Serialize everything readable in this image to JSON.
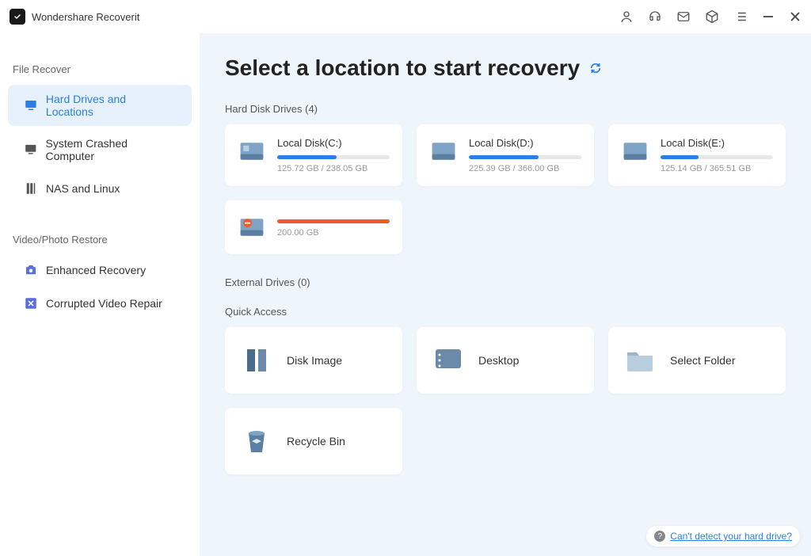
{
  "app": {
    "title": "Wondershare Recoverit"
  },
  "sidebar": {
    "section1": "File Recover",
    "section2": "Video/Photo Restore",
    "items1": [
      {
        "label": "Hard Drives and Locations"
      },
      {
        "label": "System Crashed Computer"
      },
      {
        "label": "NAS and Linux"
      }
    ],
    "items2": [
      {
        "label": "Enhanced Recovery"
      },
      {
        "label": "Corrupted Video Repair"
      }
    ]
  },
  "page": {
    "title": "Select a location to start recovery",
    "hdd_label": "Hard Disk Drives (4)",
    "ext_label": "External Drives (0)",
    "qa_label": "Quick Access"
  },
  "drives": [
    {
      "name": "Local Disk(C:)",
      "size": "125.72 GB / 238.05 GB",
      "pct": 53,
      "color": "blue"
    },
    {
      "name": "Local Disk(D:)",
      "size": "225.39 GB / 366.00 GB",
      "pct": 62,
      "color": "blue"
    },
    {
      "name": "Local Disk(E:)",
      "size": "125.14 GB / 365.51 GB",
      "pct": 34,
      "color": "blue"
    },
    {
      "name": "",
      "size": "200.00 GB",
      "pct": 100,
      "color": "red"
    }
  ],
  "quick": [
    {
      "label": "Disk Image"
    },
    {
      "label": "Desktop"
    },
    {
      "label": "Select Folder"
    },
    {
      "label": "Recycle Bin"
    }
  ],
  "help": {
    "text": "Can't detect your hard drive?"
  }
}
